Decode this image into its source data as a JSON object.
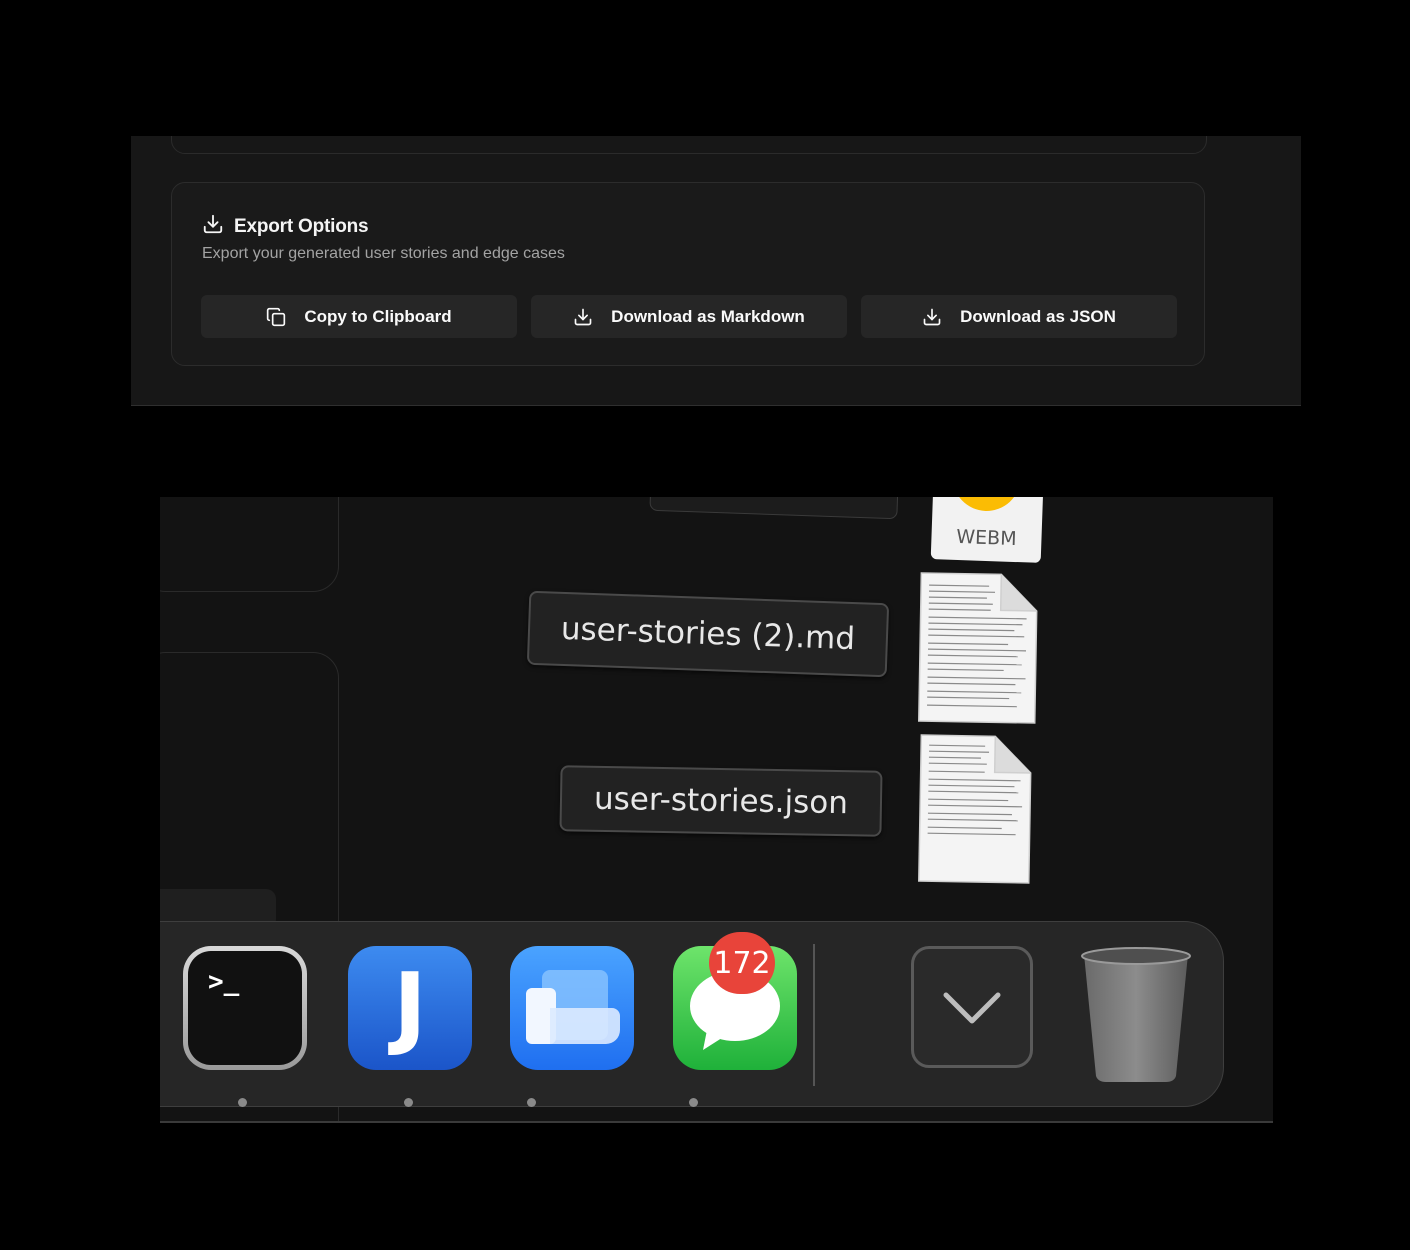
{
  "export": {
    "title": "Export Options",
    "description": "Export your generated user stories and edge cases",
    "buttons": {
      "copy": "Copy to Clipboard",
      "markdown": "Download as Markdown",
      "json": "Download as JSON"
    },
    "icons": {
      "header": "download-icon",
      "copy": "copy-icon",
      "markdown": "download-icon",
      "json": "download-icon"
    }
  },
  "desktop": {
    "files": [
      {
        "name": "user-stories (2).md"
      },
      {
        "name": "user-stories.json"
      }
    ],
    "webm_label": "WEBM"
  },
  "dock": {
    "apps": [
      "Terminal",
      "Joplin",
      "Preview",
      "Messages"
    ],
    "messages_badge": "172",
    "right_items": [
      "Downloads",
      "Trash"
    ]
  },
  "colors": {
    "panel": "#171717",
    "button": "#262626",
    "badge": "#e8443a"
  }
}
